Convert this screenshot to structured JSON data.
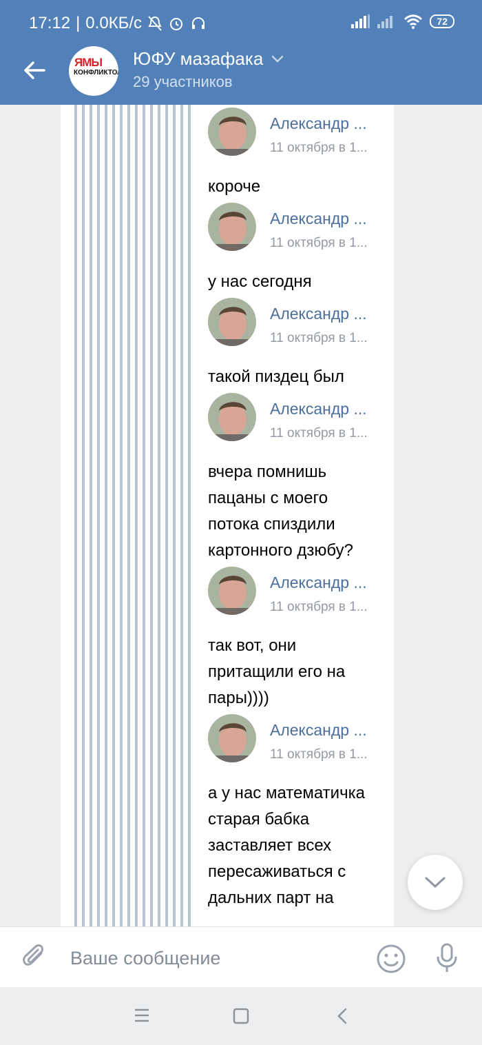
{
  "status_bar": {
    "time": "17:12",
    "speed": "0.0КБ/с",
    "battery": "72"
  },
  "header": {
    "title": "ЮФУ мазафака",
    "subtitle": "29 участников"
  },
  "messages": [
    {
      "author": "Александр ...",
      "date": "11 октября в 1...",
      "text": "короче"
    },
    {
      "author": "Александр ...",
      "date": "11 октября в 1...",
      "text": "у нас сегодня"
    },
    {
      "author": "Александр ...",
      "date": "11 октября в 1...",
      "text": "такой пиздец был"
    },
    {
      "author": "Александр ...",
      "date": "11 октября в 1...",
      "text": "вчера помнишь пацаны с моего потока спиздили картонного дзюбу?"
    },
    {
      "author": "Александр ...",
      "date": "11 октября в 1...",
      "text": "так вот, они притащили его на пары))))"
    },
    {
      "author": "Александр ...",
      "date": "11 октября в 1...",
      "text": "а у нас математичка старая бабка заставляет всех пересаживаться с дальних парт на"
    }
  ],
  "composer": {
    "placeholder": "Ваше сообщение"
  },
  "colors": {
    "header": "#5181b8",
    "author": "#4b6f9a",
    "stripe": "#b9c4d3"
  },
  "icons": [
    "back-arrow-icon",
    "chevron-down-icon",
    "attach-icon",
    "emoji-icon",
    "microphone-icon",
    "menu-icon",
    "home-icon",
    "back-icon"
  ]
}
